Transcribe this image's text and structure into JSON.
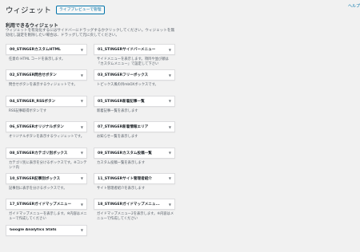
{
  "header": {
    "title": "ウィジェット",
    "manage_label": "ライブプレビューで管理",
    "help_label": "ヘルプ"
  },
  "available": {
    "title": "利用できるウィジェット",
    "description": "ウィジェットを有効化するにはサイドバーにドラッグするかクリックしてください。ウィジェットを無効化し設定を削除したい場合は、ドラッグして元に戻してください。"
  },
  "widgets": [
    {
      "name": "00_STINGERカスタムHTML",
      "desc": "任意の HTML コードを表示します。"
    },
    {
      "name": "01_STINGERサイドバーメニュー",
      "desc": "サイドメニューを表示します。項目や並び順は「カスタムメニュー」で設定して下さい"
    },
    {
      "name": "02_STINGER問合せボタン",
      "desc": "問合せボタンを表示するウィジェットです。"
    },
    {
      "name": "03_STINGERフリーボックス",
      "desc": "トピックス風の目mbOXボックスです。"
    },
    {
      "name": "04_STINGER_RSSボタン",
      "desc": "RSS記事取得ボタンです"
    },
    {
      "name": "05_STINGER新着記事一覧",
      "desc": "新着記事一覧を表示します"
    },
    {
      "name": "06_STINGERオリジナルボタン",
      "desc": "オリジナルボタンを表示するウィジェットです。"
    },
    {
      "name": "07_STINGER新着情報エリア",
      "desc": "お知らせ一覧を表示します"
    },
    {
      "name": "08_STINGERカテゴリ別ボックス",
      "desc": "カテゴリ別に表示を分けるボックスです。※コンテンツ内"
    },
    {
      "name": "09_STINGERカスタム投稿一覧",
      "desc": "カスタム投稿一覧を表示します"
    },
    {
      "name": "10_STINGER記事別ボックス",
      "desc": "記事別に表示を分けるボックスです。"
    },
    {
      "name": "11_STINGERサイト管理者紹介",
      "desc": "サイト管理者紹介を表示します"
    },
    {
      "name": "17_STINGERガイドマップメニュー",
      "desc": "ガイドマップメニューを表示します。※内容はメニューで作成してください"
    },
    {
      "name": "18_STINGERガイドマップメニュ...",
      "desc": "ガイドマップメニュー2を表示します。※内容はメニューで作成してください"
    },
    {
      "name": "Google Analytics Stats",
      "desc": ""
    }
  ]
}
